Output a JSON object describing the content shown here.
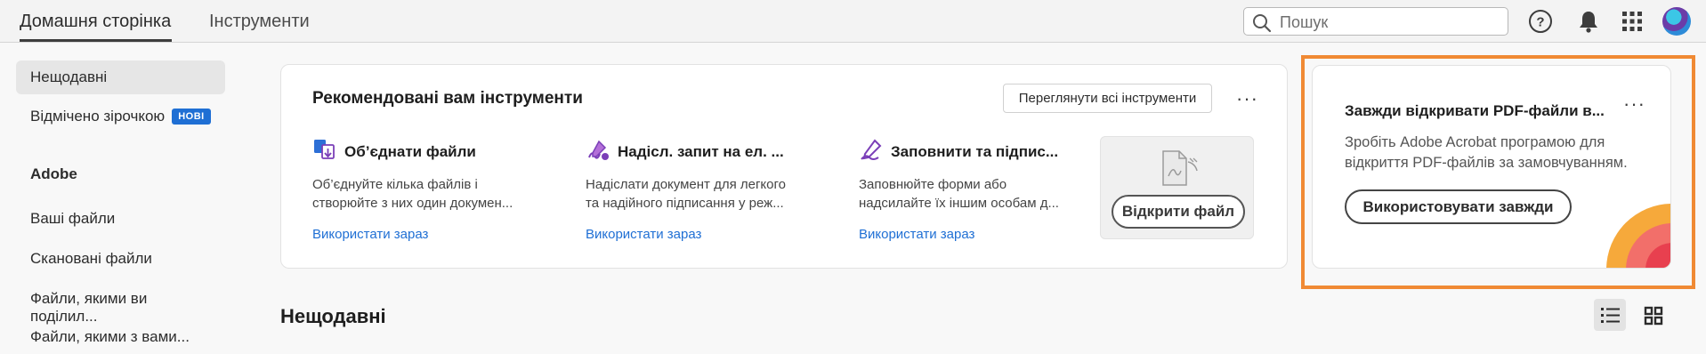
{
  "topbar": {
    "tabs": [
      {
        "label": "Домашня сторінка",
        "active": true
      },
      {
        "label": "Інструменти",
        "active": false
      }
    ],
    "search": {
      "placeholder": "Пошук"
    },
    "icons": [
      "help-icon",
      "notification-bell-icon",
      "apps-grid-icon",
      "user-avatar"
    ]
  },
  "sidebar": {
    "items": [
      {
        "label": "Нещодавні",
        "active": true
      },
      {
        "label": "Відмічено зірочкою",
        "badge": "НОВІ"
      }
    ],
    "heading": "Adobe",
    "adobe_items": [
      {
        "label": "Ваші файли"
      },
      {
        "label": "Скановані файли"
      },
      {
        "label": "Файли, якими ви поділил..."
      },
      {
        "label": "Файли, якими з вами..."
      }
    ]
  },
  "recommended": {
    "title": "Рекомендовані вам інструменти",
    "view_all_label": "Переглянути всі інструменти",
    "tools": [
      {
        "title": "Об’єднати файли",
        "desc": "Об’єднуйте кілька файлів і створюйте з них один докумен...",
        "link": "Використати зараз",
        "icon": "combine-files-icon"
      },
      {
        "title": "Надісл. запит на ел. ...",
        "desc": "Надіслати документ для легкого та надійного підписання у реж...",
        "link": "Використати зараз",
        "icon": "request-signature-icon"
      },
      {
        "title": "Заповнити та підпис...",
        "desc": "Заповнюйте форми або надсилайте їх іншим особам д...",
        "link": "Використати зараз",
        "icon": "fill-sign-icon"
      }
    ],
    "open_file_label": "Відкрити файл"
  },
  "promo": {
    "title": "Завжди відкривати PDF-файли в...",
    "desc": "Зробіть Adobe Acrobat програмою для відкриття PDF-файлів за замовчуванням.",
    "button_label": "Використовувати завжди"
  },
  "recent": {
    "title": "Нещодавні",
    "views": [
      "list-view-icon",
      "grid-view-icon"
    ]
  },
  "colors": {
    "accent_blue": "#1f6fd4",
    "highlight_orange": "#f08a34",
    "tool_purple": "#7b3fb8"
  }
}
